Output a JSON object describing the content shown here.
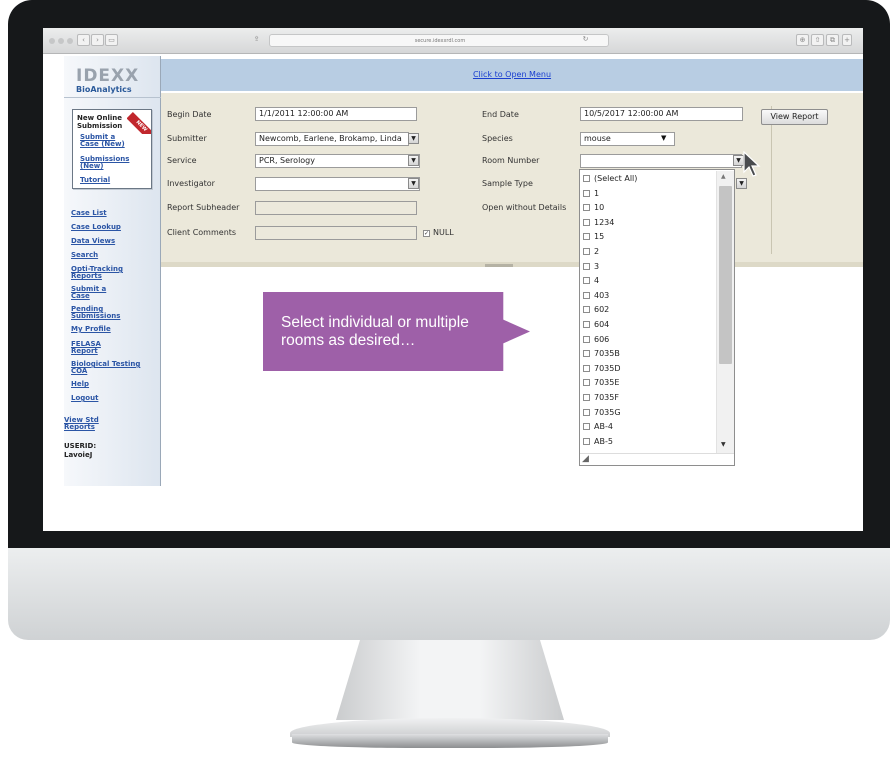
{
  "browser": {
    "url": "secure.idexxrdl.com"
  },
  "sidebar": {
    "logo": "IDEXX",
    "brand": "BioAnalytics",
    "submission_box": {
      "title": "New Online Submission",
      "ribbon": "NEW",
      "links": [
        "Submit a Case (New)",
        "Submissions (New)",
        "Tutorial"
      ]
    },
    "nav": [
      "Case List",
      "Case Lookup",
      "Data Views",
      "Search",
      "Opti-Tracking Reports",
      "Submit a Case",
      "Pending Submissions",
      "My Profile",
      "FELASA Report",
      "Biological Testing COA",
      "Help",
      "Logout"
    ],
    "view_std": "View Std Reports",
    "userid_label": "USERID:",
    "userid": "LavoieJ"
  },
  "header": {
    "menu_link": "Click to Open Menu"
  },
  "form": {
    "begin_date_label": "Begin Date",
    "begin_date": "1/1/2011 12:00:00 AM",
    "end_date_label": "End Date",
    "end_date": "10/5/2017 12:00:00 AM",
    "submitter_label": "Submitter",
    "submitter": "Newcomb, Earlene, Brokamp, Linda",
    "species_label": "Species",
    "species": "mouse",
    "service_label": "Service",
    "service": "PCR, Serology",
    "room_label": "Room Number",
    "room": "",
    "investigator_label": "Investigator",
    "investigator": "",
    "sample_type_label": "Sample Type",
    "report_subheader_label": "Report Subheader",
    "open_without_details_label": "Open without Details",
    "client_comments_label": "Client Comments",
    "null_label": "NULL",
    "view_report": "View Report"
  },
  "room_options": [
    "(Select All)",
    "1",
    "10",
    "1234",
    "15",
    "2",
    "3",
    "4",
    "403",
    "602",
    "604",
    "606",
    "7035B",
    "7035D",
    "7035E",
    "7035F",
    "7035G",
    "AB-4",
    "AB-5"
  ],
  "callout": "Select individual or multiple rooms as desired…"
}
